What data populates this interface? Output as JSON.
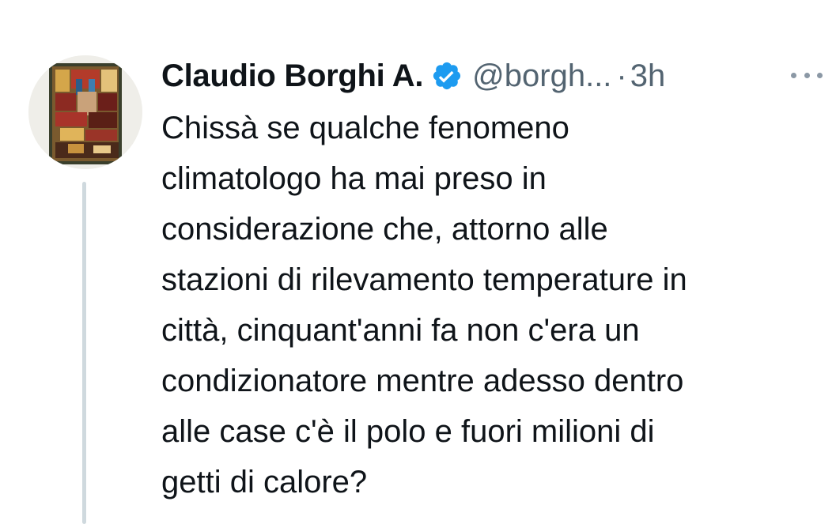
{
  "tweet": {
    "author_name": "Claudio Borghi A.",
    "verified_icon": "verified-badge-icon",
    "handle": "@borgh...",
    "separator": "·",
    "time": "3h",
    "more_icon": "more-horizontal-icon",
    "text": "Chissà se qualche fenomeno\nclimatologo ha mai preso in\nconsiderazione che, attorno alle\nstazioni di rilevamento temperature in\ncittà, cinquant'anni fa non c'era un\ncondizionatore mentre adesso dentro\nalle case c'è il polo e fuori milioni di\ngetti di calore?"
  },
  "colors": {
    "verified_blue": "#1d9bf0",
    "secondary_text": "#536471",
    "thread_line": "#cfd9de"
  }
}
